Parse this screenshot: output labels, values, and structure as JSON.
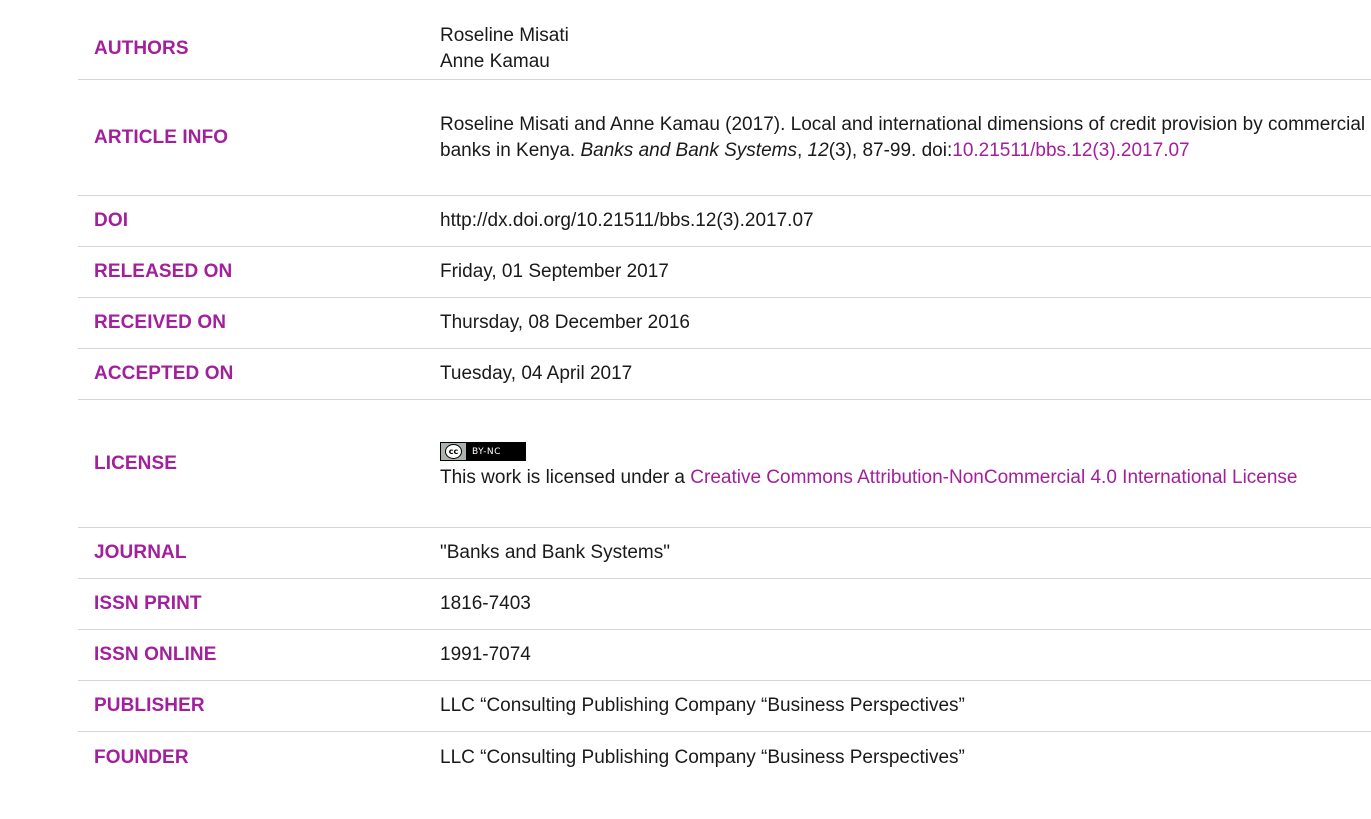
{
  "authors": {
    "label": "AUTHORS",
    "names": [
      "Roseline Misati",
      "Anne Kamau"
    ]
  },
  "article_info": {
    "label": "ARTICLE INFO",
    "text_before": "Roseline Misati and Anne Kamau (2017). Local and international dimensions of credit provision by commercial banks in Kenya. ",
    "journal_italic": "Banks and Bank Systems",
    "comma1": ", ",
    "volume_italic": "12",
    "issue_pages": "(3), 87-99. doi:",
    "doi_link": "10.21511/bbs.12(3).2017.07"
  },
  "doi": {
    "label": "DOI",
    "value": "http://dx.doi.org/10.21511/bbs.12(3).2017.07"
  },
  "released_on": {
    "label": "RELEASED ON",
    "value": "Friday, 01 September 2017"
  },
  "received_on": {
    "label": "RECEIVED ON",
    "value": "Thursday, 08 December 2016"
  },
  "accepted_on": {
    "label": "ACCEPTED ON",
    "value": "Tuesday, 04 April 2017"
  },
  "license": {
    "label": "LICENSE",
    "badge_cc": "cc",
    "badge_terms": "BY-NC",
    "text_before": "This work is licensed under a ",
    "link_text": "Creative Commons Attribution-NonCommercial 4.0 International License"
  },
  "journal": {
    "label": "JOURNAL",
    "value": "\"Banks and Bank Systems\""
  },
  "issn_print": {
    "label": "ISSN PRINT",
    "value": "1816-7403"
  },
  "issn_online": {
    "label": "ISSN ONLINE",
    "value": "1991-7074"
  },
  "publisher": {
    "label": "PUBLISHER",
    "value": "LLC “Consulting Publishing Company “Business Perspectives”"
  },
  "founder": {
    "label": "FOUNDER",
    "value": "LLC “Consulting Publishing Company “Business Perspectives”"
  },
  "colors": {
    "accent": "#a3209c",
    "text": "#1a1a1a",
    "divider": "#d6d6d6"
  }
}
